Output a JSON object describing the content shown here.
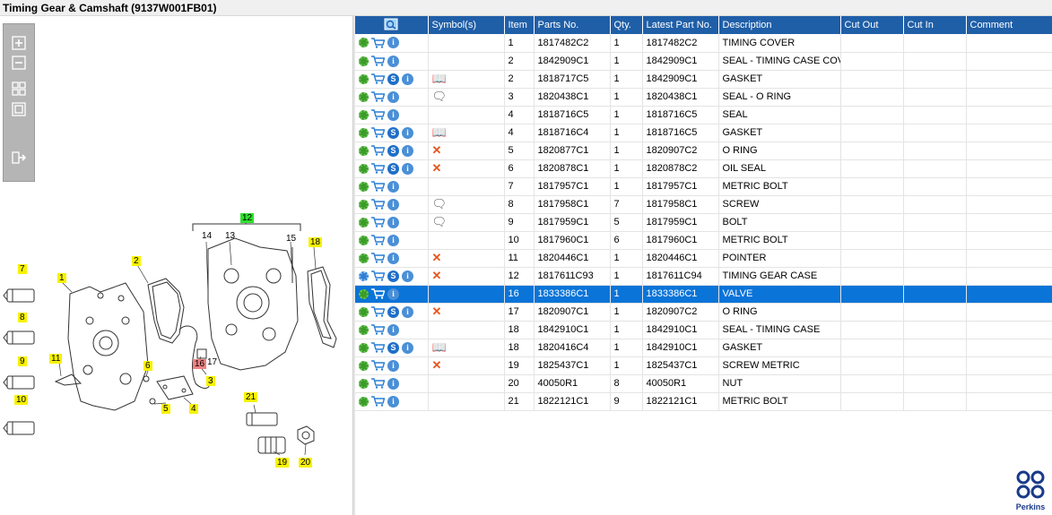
{
  "window": {
    "title": "Timing Gear & Camshaft (9137W001FB01)"
  },
  "toolbar": {
    "zoom_in": "zoom-in-icon",
    "zoom_out": "zoom-out-icon",
    "fit_all": "fit-all-icon",
    "fit_page": "fit-page-icon",
    "export": "export-icon"
  },
  "diagram": {
    "callouts": [
      "1",
      "2",
      "3",
      "4",
      "5",
      "6",
      "7",
      "8",
      "9",
      "10",
      "11",
      "12",
      "13",
      "14",
      "15",
      "16",
      "17",
      "18",
      "19",
      "20",
      "21"
    ],
    "plain_labels": {
      "p13": "13",
      "p14": "14",
      "p15": "15",
      "p17": "17"
    }
  },
  "table": {
    "columns": [
      "",
      "Symbol(s)",
      "Item",
      "Parts No.",
      "Qty.",
      "Latest Part No.",
      "Description",
      "Cut Out",
      "Cut In",
      "Comment"
    ],
    "rows": [
      {
        "icons": [
          "gear",
          "cart",
          "info"
        ],
        "symbol": "",
        "item": "1",
        "part": "1817482C2",
        "qty": "1",
        "latest": "1817482C2",
        "desc": "TIMING COVER",
        "cutout": "",
        "cutin": "",
        "comment": ""
      },
      {
        "icons": [
          "gear",
          "cart",
          "info"
        ],
        "symbol": "",
        "item": "2",
        "part": "1842909C1",
        "qty": "1",
        "latest": "1842909C1",
        "desc": "SEAL - TIMING CASE COVE",
        "cutout": "",
        "cutin": "",
        "comment": ""
      },
      {
        "icons": [
          "gear",
          "cart",
          "s",
          "info"
        ],
        "symbol": "book",
        "item": "2",
        "part": "1818717C5",
        "qty": "1",
        "latest": "1842909C1",
        "desc": "GASKET",
        "cutout": "",
        "cutin": "",
        "comment": ""
      },
      {
        "icons": [
          "gear",
          "cart",
          "info"
        ],
        "symbol": "note",
        "item": "3",
        "part": "1820438C1",
        "qty": "1",
        "latest": "1820438C1",
        "desc": "SEAL - O RING",
        "cutout": "",
        "cutin": "",
        "comment": ""
      },
      {
        "icons": [
          "gear",
          "cart",
          "info"
        ],
        "symbol": "",
        "item": "4",
        "part": "1818716C5",
        "qty": "1",
        "latest": "1818716C5",
        "desc": "SEAL",
        "cutout": "",
        "cutin": "",
        "comment": ""
      },
      {
        "icons": [
          "gear",
          "cart",
          "s",
          "info"
        ],
        "symbol": "book",
        "item": "4",
        "part": "1818716C4",
        "qty": "1",
        "latest": "1818716C5",
        "desc": "GASKET",
        "cutout": "",
        "cutin": "",
        "comment": ""
      },
      {
        "icons": [
          "gear",
          "cart",
          "s",
          "info"
        ],
        "symbol": "x",
        "item": "5",
        "part": "1820877C1",
        "qty": "1",
        "latest": "1820907C2",
        "desc": "O RING",
        "cutout": "",
        "cutin": "",
        "comment": ""
      },
      {
        "icons": [
          "gear",
          "cart",
          "s",
          "info"
        ],
        "symbol": "x",
        "item": "6",
        "part": "1820878C1",
        "qty": "1",
        "latest": "1820878C2",
        "desc": "OIL SEAL",
        "cutout": "",
        "cutin": "",
        "comment": ""
      },
      {
        "icons": [
          "gear",
          "cart",
          "info"
        ],
        "symbol": "",
        "item": "7",
        "part": "1817957C1",
        "qty": "1",
        "latest": "1817957C1",
        "desc": "METRIC BOLT",
        "cutout": "",
        "cutin": "",
        "comment": ""
      },
      {
        "icons": [
          "gear",
          "cart",
          "info"
        ],
        "symbol": "note",
        "item": "8",
        "part": "1817958C1",
        "qty": "7",
        "latest": "1817958C1",
        "desc": "SCREW",
        "cutout": "",
        "cutin": "",
        "comment": ""
      },
      {
        "icons": [
          "gear",
          "cart",
          "info"
        ],
        "symbol": "note",
        "item": "9",
        "part": "1817959C1",
        "qty": "5",
        "latest": "1817959C1",
        "desc": "BOLT",
        "cutout": "",
        "cutin": "",
        "comment": ""
      },
      {
        "icons": [
          "gear",
          "cart",
          "info"
        ],
        "symbol": "",
        "item": "10",
        "part": "1817960C1",
        "qty": "6",
        "latest": "1817960C1",
        "desc": "METRIC BOLT",
        "cutout": "",
        "cutin": "",
        "comment": ""
      },
      {
        "icons": [
          "gear",
          "cart",
          "info"
        ],
        "symbol": "x",
        "item": "11",
        "part": "1820446C1",
        "qty": "1",
        "latest": "1820446C1",
        "desc": "POINTER",
        "cutout": "",
        "cutin": "",
        "comment": ""
      },
      {
        "icons": [
          "gear2",
          "cart",
          "s",
          "info"
        ],
        "symbol": "x",
        "item": "12",
        "part": "1817611C93",
        "qty": "1",
        "latest": "1817611C94",
        "desc": "TIMING GEAR CASE",
        "cutout": "",
        "cutin": "",
        "comment": ""
      },
      {
        "icons": [
          "gear",
          "cart",
          "info"
        ],
        "symbol": "",
        "item": "16",
        "part": "1833386C1",
        "qty": "1",
        "latest": "1833386C1",
        "desc": "VALVE",
        "cutout": "",
        "cutin": "",
        "comment": "",
        "selected": true
      },
      {
        "icons": [
          "gear",
          "cart",
          "s",
          "info"
        ],
        "symbol": "x",
        "item": "17",
        "part": "1820907C1",
        "qty": "1",
        "latest": "1820907C2",
        "desc": "O RING",
        "cutout": "",
        "cutin": "",
        "comment": ""
      },
      {
        "icons": [
          "gear",
          "cart",
          "info"
        ],
        "symbol": "",
        "item": "18",
        "part": "1842910C1",
        "qty": "1",
        "latest": "1842910C1",
        "desc": "SEAL - TIMING CASE",
        "cutout": "",
        "cutin": "",
        "comment": ""
      },
      {
        "icons": [
          "gear",
          "cart",
          "s",
          "info"
        ],
        "symbol": "book",
        "item": "18",
        "part": "1820416C4",
        "qty": "1",
        "latest": "1842910C1",
        "desc": "GASKET",
        "cutout": "",
        "cutin": "",
        "comment": ""
      },
      {
        "icons": [
          "gear",
          "cart",
          "info"
        ],
        "symbol": "x",
        "item": "19",
        "part": "1825437C1",
        "qty": "1",
        "latest": "1825437C1",
        "desc": "SCREW METRIC",
        "cutout": "",
        "cutin": "",
        "comment": ""
      },
      {
        "icons": [
          "gear",
          "cart",
          "info"
        ],
        "symbol": "",
        "item": "20",
        "part": "40050R1",
        "qty": "8",
        "latest": "40050R1",
        "desc": "NUT",
        "cutout": "",
        "cutin": "",
        "comment": ""
      },
      {
        "icons": [
          "gear",
          "cart",
          "info"
        ],
        "symbol": "",
        "item": "21",
        "part": "1822121C1",
        "qty": "9",
        "latest": "1822121C1",
        "desc": "METRIC BOLT",
        "cutout": "",
        "cutin": "",
        "comment": ""
      }
    ]
  },
  "brand": {
    "name": "Perkins",
    "color": "#1a3a8a"
  },
  "colors": {
    "header": "#1f5fa8",
    "selected": "#0a74d8",
    "callout": "#f7f200",
    "callout_highlight": "#f08080",
    "callout_group": "#2fe02f"
  }
}
